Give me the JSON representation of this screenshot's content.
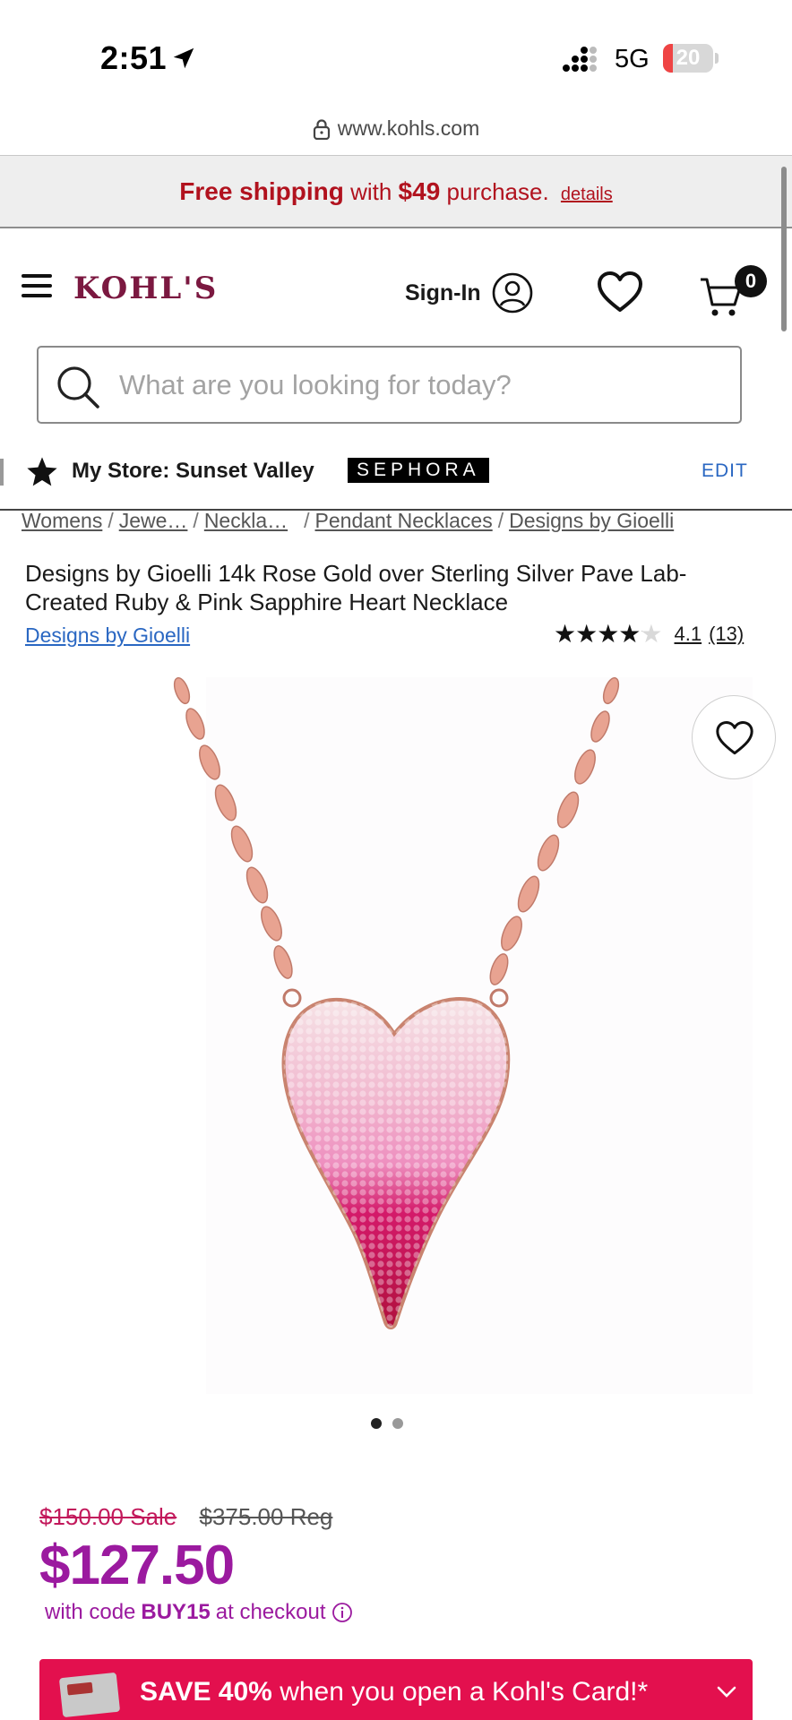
{
  "status_bar": {
    "time": "2:51",
    "network": "5G",
    "battery": "20",
    "battery_level": 0.2
  },
  "browser": {
    "url": "www.kohls.com"
  },
  "shipping_banner": {
    "bold_text": "Free shipping",
    "text_mid": "with",
    "amount": "$49",
    "text_end": "purchase.",
    "details_link": "details"
  },
  "header": {
    "logo": "KOHL'S",
    "sign_in_label": "Sign-In",
    "cart_count": "0"
  },
  "search": {
    "placeholder": "What are you looking for today?"
  },
  "store": {
    "label": "My Store: Sunset Valley",
    "sephora": "SEPHORA",
    "edit": "EDIT"
  },
  "breadcrumb": [
    "Womens",
    "Jewe…",
    "Neckla…",
    "Pendant Necklaces",
    "Designs by Gioelli"
  ],
  "product": {
    "title": "Designs by Gioelli 14k Rose Gold over Sterling Silver Pave Lab-Created Ruby & Pink Sapphire Heart Necklace",
    "brand": "Designs by Gioelli",
    "rating": "4.1",
    "rating_value": 4.1,
    "rating_max": 5,
    "review_count": "(13)",
    "stars_glyphs": "★★★★★",
    "image_count": 2,
    "active_image": 0
  },
  "price": {
    "sale": "$150.00 Sale",
    "regular": "$375.00 Reg",
    "current": "$127.50",
    "promo_prefix": "with code",
    "promo_code": "BUY15",
    "promo_suffix": "at checkout"
  },
  "card_banner": {
    "bold": "SAVE 40%",
    "text": "when you open a Kohl's Card!*"
  },
  "colors": {
    "brand": "#7b1840",
    "price": "#9b1a9f",
    "sale": "#c2185b",
    "banner": "#e3104e",
    "link": "#2a67c2",
    "shipping": "#b1121e"
  }
}
